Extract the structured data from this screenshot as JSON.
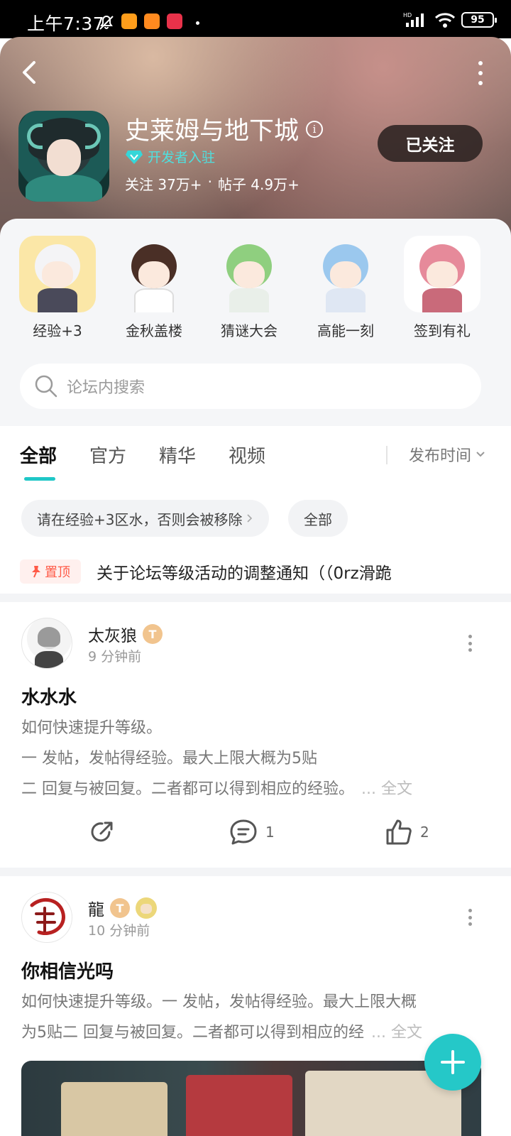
{
  "status_bar": {
    "time": "上午7:37",
    "battery": "95"
  },
  "forum": {
    "title": "史莱姆与地下城",
    "dev_badge": "开发者入驻",
    "followers": "关注 37万+",
    "separator": "·",
    "posts": "帖子 4.9万+",
    "follow_label": "已关注"
  },
  "characters": [
    {
      "label": "经验+3"
    },
    {
      "label": "金秋盖楼"
    },
    {
      "label": "猜谜大会"
    },
    {
      "label": "高能一刻"
    },
    {
      "label": "签到有礼"
    }
  ],
  "search": {
    "placeholder": "论坛内搜索"
  },
  "tabs": [
    "全部",
    "官方",
    "精华",
    "视频"
  ],
  "sort_label": "发布时间",
  "chips": [
    "请在经验+3区水，否则会被移除",
    "全部"
  ],
  "pinned": {
    "badge": "置顶",
    "text": "关于论坛等级活动的调整通知（（0rz滑跪"
  },
  "posts": [
    {
      "author": "太灰狼",
      "level": "T",
      "time": "9 分钟前",
      "title": "水水水",
      "lines": [
        "如何快速提升等级。",
        "一 发帖，发帖得经验。最大上限大概为5贴",
        "二 回复与被回复。二者都可以得到相应的经验。"
      ],
      "more": "... 全文",
      "comments": "1",
      "likes": "2"
    },
    {
      "author": "龍",
      "level": "T",
      "time": "10 分钟前",
      "title": "你相信光吗",
      "lines": [
        "如何快速提升等级。一 发帖，发帖得经验。最大上限大概",
        "为5贴二 回复与被回复。二者都可以得到相应的经"
      ],
      "more": "... 全文"
    }
  ],
  "colors": {
    "accent": "#25c8c8",
    "pin": "#ff5a47"
  }
}
